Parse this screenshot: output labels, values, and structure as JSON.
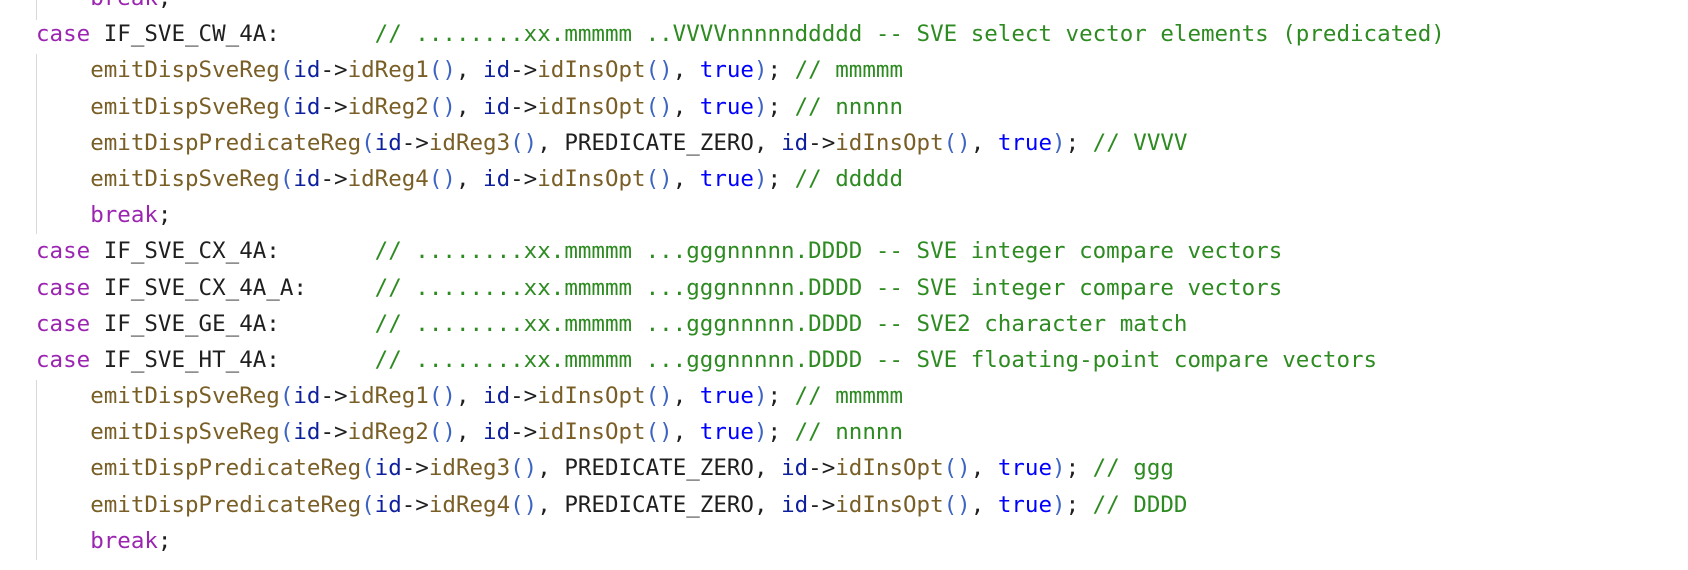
{
  "code_lines": [
    {
      "indent": "    ",
      "tokens": [
        {
          "text": "break",
          "cls": "t-brk"
        },
        {
          "text": ";",
          "cls": "t-p"
        }
      ]
    },
    {
      "indent": "",
      "tokens": [
        {
          "text": "case",
          "cls": "t-kw"
        },
        {
          "text": " IF_SVE_CW_4A:       ",
          "cls": "t-id"
        },
        {
          "text": "// ........xx.mmmmm ..VVVVnnnnnddddd -- SVE select vector elements (predicated)",
          "cls": "t-cm"
        }
      ]
    },
    {
      "indent": "    ",
      "tokens": [
        {
          "text": "emitDispSveReg",
          "cls": "t-fn"
        },
        {
          "text": "(",
          "cls": "t-b"
        },
        {
          "text": "id",
          "cls": "t-var"
        },
        {
          "text": "->",
          "cls": "t-p"
        },
        {
          "text": "idReg1",
          "cls": "t-fn"
        },
        {
          "text": "()",
          "cls": "t-b"
        },
        {
          "text": ", ",
          "cls": "t-p"
        },
        {
          "text": "id",
          "cls": "t-var"
        },
        {
          "text": "->",
          "cls": "t-p"
        },
        {
          "text": "idInsOpt",
          "cls": "t-fn"
        },
        {
          "text": "()",
          "cls": "t-b"
        },
        {
          "text": ", ",
          "cls": "t-p"
        },
        {
          "text": "true",
          "cls": "t-lit"
        },
        {
          "text": ")",
          "cls": "t-b"
        },
        {
          "text": "; ",
          "cls": "t-p"
        },
        {
          "text": "// mmmmm",
          "cls": "t-cm"
        }
      ]
    },
    {
      "indent": "    ",
      "tokens": [
        {
          "text": "emitDispSveReg",
          "cls": "t-fn"
        },
        {
          "text": "(",
          "cls": "t-b"
        },
        {
          "text": "id",
          "cls": "t-var"
        },
        {
          "text": "->",
          "cls": "t-p"
        },
        {
          "text": "idReg2",
          "cls": "t-fn"
        },
        {
          "text": "()",
          "cls": "t-b"
        },
        {
          "text": ", ",
          "cls": "t-p"
        },
        {
          "text": "id",
          "cls": "t-var"
        },
        {
          "text": "->",
          "cls": "t-p"
        },
        {
          "text": "idInsOpt",
          "cls": "t-fn"
        },
        {
          "text": "()",
          "cls": "t-b"
        },
        {
          "text": ", ",
          "cls": "t-p"
        },
        {
          "text": "true",
          "cls": "t-lit"
        },
        {
          "text": ")",
          "cls": "t-b"
        },
        {
          "text": "; ",
          "cls": "t-p"
        },
        {
          "text": "// nnnnn",
          "cls": "t-cm"
        }
      ]
    },
    {
      "indent": "    ",
      "tokens": [
        {
          "text": "emitDispPredicateReg",
          "cls": "t-fn"
        },
        {
          "text": "(",
          "cls": "t-b"
        },
        {
          "text": "id",
          "cls": "t-var"
        },
        {
          "text": "->",
          "cls": "t-p"
        },
        {
          "text": "idReg3",
          "cls": "t-fn"
        },
        {
          "text": "()",
          "cls": "t-b"
        },
        {
          "text": ", PREDICATE_ZERO, ",
          "cls": "t-const"
        },
        {
          "text": "id",
          "cls": "t-var"
        },
        {
          "text": "->",
          "cls": "t-p"
        },
        {
          "text": "idInsOpt",
          "cls": "t-fn"
        },
        {
          "text": "()",
          "cls": "t-b"
        },
        {
          "text": ", ",
          "cls": "t-p"
        },
        {
          "text": "true",
          "cls": "t-lit"
        },
        {
          "text": ")",
          "cls": "t-b"
        },
        {
          "text": "; ",
          "cls": "t-p"
        },
        {
          "text": "// VVVV",
          "cls": "t-cm"
        }
      ]
    },
    {
      "indent": "    ",
      "tokens": [
        {
          "text": "emitDispSveReg",
          "cls": "t-fn"
        },
        {
          "text": "(",
          "cls": "t-b"
        },
        {
          "text": "id",
          "cls": "t-var"
        },
        {
          "text": "->",
          "cls": "t-p"
        },
        {
          "text": "idReg4",
          "cls": "t-fn"
        },
        {
          "text": "()",
          "cls": "t-b"
        },
        {
          "text": ", ",
          "cls": "t-p"
        },
        {
          "text": "id",
          "cls": "t-var"
        },
        {
          "text": "->",
          "cls": "t-p"
        },
        {
          "text": "idInsOpt",
          "cls": "t-fn"
        },
        {
          "text": "()",
          "cls": "t-b"
        },
        {
          "text": ", ",
          "cls": "t-p"
        },
        {
          "text": "true",
          "cls": "t-lit"
        },
        {
          "text": ")",
          "cls": "t-b"
        },
        {
          "text": "; ",
          "cls": "t-p"
        },
        {
          "text": "// ddddd",
          "cls": "t-cm"
        }
      ]
    },
    {
      "indent": "    ",
      "tokens": [
        {
          "text": "break",
          "cls": "t-brk"
        },
        {
          "text": ";",
          "cls": "t-p"
        }
      ]
    },
    {
      "indent": "",
      "tokens": [
        {
          "text": "case",
          "cls": "t-kw"
        },
        {
          "text": " IF_SVE_CX_4A:       ",
          "cls": "t-id"
        },
        {
          "text": "// ........xx.mmmmm ...gggnnnnn.DDDD -- SVE integer compare vectors",
          "cls": "t-cm"
        }
      ]
    },
    {
      "indent": "",
      "tokens": [
        {
          "text": "case",
          "cls": "t-kw"
        },
        {
          "text": " IF_SVE_CX_4A_A:     ",
          "cls": "t-id"
        },
        {
          "text": "// ........xx.mmmmm ...gggnnnnn.DDDD -- SVE integer compare vectors",
          "cls": "t-cm"
        }
      ]
    },
    {
      "indent": "",
      "tokens": [
        {
          "text": "case",
          "cls": "t-kw"
        },
        {
          "text": " IF_SVE_GE_4A:       ",
          "cls": "t-id"
        },
        {
          "text": "// ........xx.mmmmm ...gggnnnnn.DDDD -- SVE2 character match",
          "cls": "t-cm"
        }
      ]
    },
    {
      "indent": "",
      "tokens": [
        {
          "text": "case",
          "cls": "t-kw"
        },
        {
          "text": " IF_SVE_HT_4A:       ",
          "cls": "t-id"
        },
        {
          "text": "// ........xx.mmmmm ...gggnnnnn.DDDD -- SVE floating-point compare vectors",
          "cls": "t-cm"
        }
      ]
    },
    {
      "indent": "    ",
      "tokens": [
        {
          "text": "emitDispSveReg",
          "cls": "t-fn"
        },
        {
          "text": "(",
          "cls": "t-b"
        },
        {
          "text": "id",
          "cls": "t-var"
        },
        {
          "text": "->",
          "cls": "t-p"
        },
        {
          "text": "idReg1",
          "cls": "t-fn"
        },
        {
          "text": "()",
          "cls": "t-b"
        },
        {
          "text": ", ",
          "cls": "t-p"
        },
        {
          "text": "id",
          "cls": "t-var"
        },
        {
          "text": "->",
          "cls": "t-p"
        },
        {
          "text": "idInsOpt",
          "cls": "t-fn"
        },
        {
          "text": "()",
          "cls": "t-b"
        },
        {
          "text": ", ",
          "cls": "t-p"
        },
        {
          "text": "true",
          "cls": "t-lit"
        },
        {
          "text": ")",
          "cls": "t-b"
        },
        {
          "text": "; ",
          "cls": "t-p"
        },
        {
          "text": "// mmmmm",
          "cls": "t-cm"
        }
      ]
    },
    {
      "indent": "    ",
      "tokens": [
        {
          "text": "emitDispSveReg",
          "cls": "t-fn"
        },
        {
          "text": "(",
          "cls": "t-b"
        },
        {
          "text": "id",
          "cls": "t-var"
        },
        {
          "text": "->",
          "cls": "t-p"
        },
        {
          "text": "idReg2",
          "cls": "t-fn"
        },
        {
          "text": "()",
          "cls": "t-b"
        },
        {
          "text": ", ",
          "cls": "t-p"
        },
        {
          "text": "id",
          "cls": "t-var"
        },
        {
          "text": "->",
          "cls": "t-p"
        },
        {
          "text": "idInsOpt",
          "cls": "t-fn"
        },
        {
          "text": "()",
          "cls": "t-b"
        },
        {
          "text": ", ",
          "cls": "t-p"
        },
        {
          "text": "true",
          "cls": "t-lit"
        },
        {
          "text": ")",
          "cls": "t-b"
        },
        {
          "text": "; ",
          "cls": "t-p"
        },
        {
          "text": "// nnnnn",
          "cls": "t-cm"
        }
      ]
    },
    {
      "indent": "    ",
      "tokens": [
        {
          "text": "emitDispPredicateReg",
          "cls": "t-fn"
        },
        {
          "text": "(",
          "cls": "t-b"
        },
        {
          "text": "id",
          "cls": "t-var"
        },
        {
          "text": "->",
          "cls": "t-p"
        },
        {
          "text": "idReg3",
          "cls": "t-fn"
        },
        {
          "text": "()",
          "cls": "t-b"
        },
        {
          "text": ", PREDICATE_ZERO, ",
          "cls": "t-const"
        },
        {
          "text": "id",
          "cls": "t-var"
        },
        {
          "text": "->",
          "cls": "t-p"
        },
        {
          "text": "idInsOpt",
          "cls": "t-fn"
        },
        {
          "text": "()",
          "cls": "t-b"
        },
        {
          "text": ", ",
          "cls": "t-p"
        },
        {
          "text": "true",
          "cls": "t-lit"
        },
        {
          "text": ")",
          "cls": "t-b"
        },
        {
          "text": "; ",
          "cls": "t-p"
        },
        {
          "text": "// ggg",
          "cls": "t-cm"
        }
      ]
    },
    {
      "indent": "    ",
      "tokens": [
        {
          "text": "emitDispPredicateReg",
          "cls": "t-fn"
        },
        {
          "text": "(",
          "cls": "t-b"
        },
        {
          "text": "id",
          "cls": "t-var"
        },
        {
          "text": "->",
          "cls": "t-p"
        },
        {
          "text": "idReg4",
          "cls": "t-fn"
        },
        {
          "text": "()",
          "cls": "t-b"
        },
        {
          "text": ", PREDICATE_ZERO, ",
          "cls": "t-const"
        },
        {
          "text": "id",
          "cls": "t-var"
        },
        {
          "text": "->",
          "cls": "t-p"
        },
        {
          "text": "idInsOpt",
          "cls": "t-fn"
        },
        {
          "text": "()",
          "cls": "t-b"
        },
        {
          "text": ", ",
          "cls": "t-p"
        },
        {
          "text": "true",
          "cls": "t-lit"
        },
        {
          "text": ")",
          "cls": "t-b"
        },
        {
          "text": "; ",
          "cls": "t-p"
        },
        {
          "text": "// DDDD",
          "cls": "t-cm"
        }
      ]
    },
    {
      "indent": "    ",
      "tokens": [
        {
          "text": "break",
          "cls": "t-brk"
        },
        {
          "text": ";",
          "cls": "t-p"
        }
      ]
    }
  ]
}
